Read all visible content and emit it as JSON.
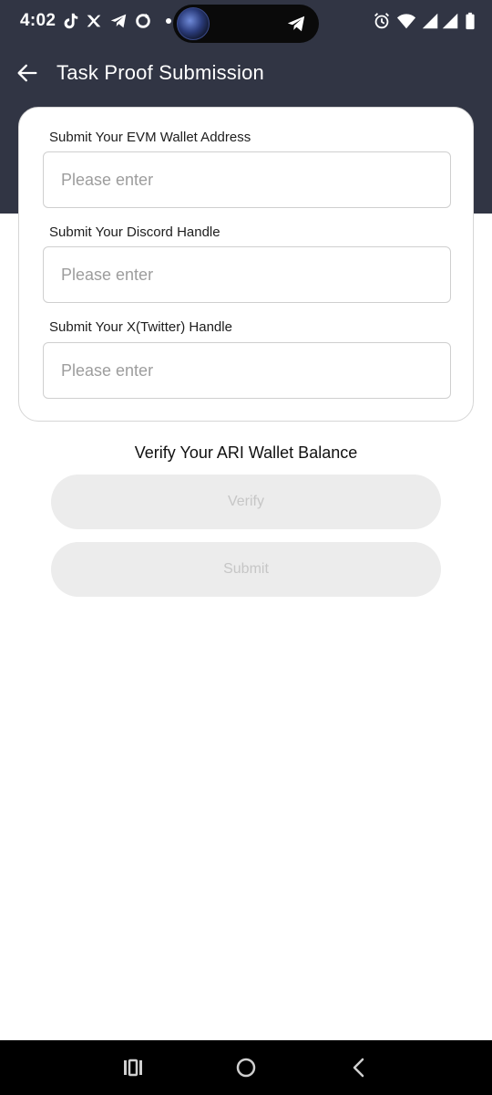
{
  "status_bar": {
    "time": "4:02",
    "left_icons": [
      "tiktok-icon",
      "x-app-icon",
      "telegram-icon",
      "sync-icon"
    ],
    "right_icons": [
      "alarm-icon",
      "wifi-icon",
      "signal-icon",
      "signal-icon",
      "battery-icon"
    ]
  },
  "header": {
    "title": "Task Proof Submission",
    "background_color": "#313544"
  },
  "form": {
    "fields": [
      {
        "label": "Submit Your EVM Wallet Address",
        "value": "",
        "placeholder": "Please enter"
      },
      {
        "label": "Submit Your Discord Handle",
        "value": "",
        "placeholder": "Please enter"
      },
      {
        "label": "Submit Your X(Twitter) Handle",
        "value": "",
        "placeholder": "Please enter"
      }
    ]
  },
  "verify": {
    "heading": "Verify Your ARI Wallet Balance",
    "verify_label": "Verify",
    "submit_label": "Submit",
    "disabled_bg": "#ececec",
    "disabled_text": "#c6c6c6"
  },
  "nav_bar": {
    "buttons": [
      "recents-icon",
      "home-icon",
      "back-nav-icon"
    ]
  }
}
